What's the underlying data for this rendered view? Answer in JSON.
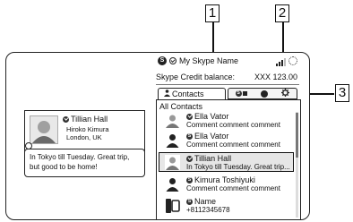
{
  "callouts": [
    "1",
    "2",
    "3"
  ],
  "header": {
    "account_name": "My Skype Name",
    "credit_label": "Skype Credit balance:",
    "credit_value": "XXX 123.00"
  },
  "tabs": {
    "contacts_label": "Contacts",
    "icons": [
      "skype-filter-icon",
      "status-online-icon",
      "settings-gear-icon"
    ]
  },
  "list": {
    "heading": "All Contacts",
    "rows": [
      {
        "name": "Ella Vator",
        "comment": "Comment comment comment",
        "avatar": "photo-avatar-icon",
        "selected": false
      },
      {
        "name": "Ella Vator",
        "comment": "Comment comment comment",
        "avatar": "person-silhouette-icon",
        "selected": false
      },
      {
        "name": "Tillian Hall",
        "comment": "In Tokyo till Tuesday. Great trip...",
        "avatar": "photo-avatar-icon",
        "selected": true
      },
      {
        "name": "Kimura Toshiyuki",
        "comment": "Comment comment comment",
        "avatar": "person-silhouette-icon",
        "selected": false
      },
      {
        "name": "Name",
        "comment": "+8112345678",
        "avatar": "phone-contact-icon",
        "selected": false
      }
    ]
  },
  "profile_card": {
    "name": "Tillian Hall",
    "line1": "Hiroko Kimura",
    "line2": "London, UK",
    "mood": "In Tokyo till Tuesday. Great trip, but good to be home!"
  }
}
